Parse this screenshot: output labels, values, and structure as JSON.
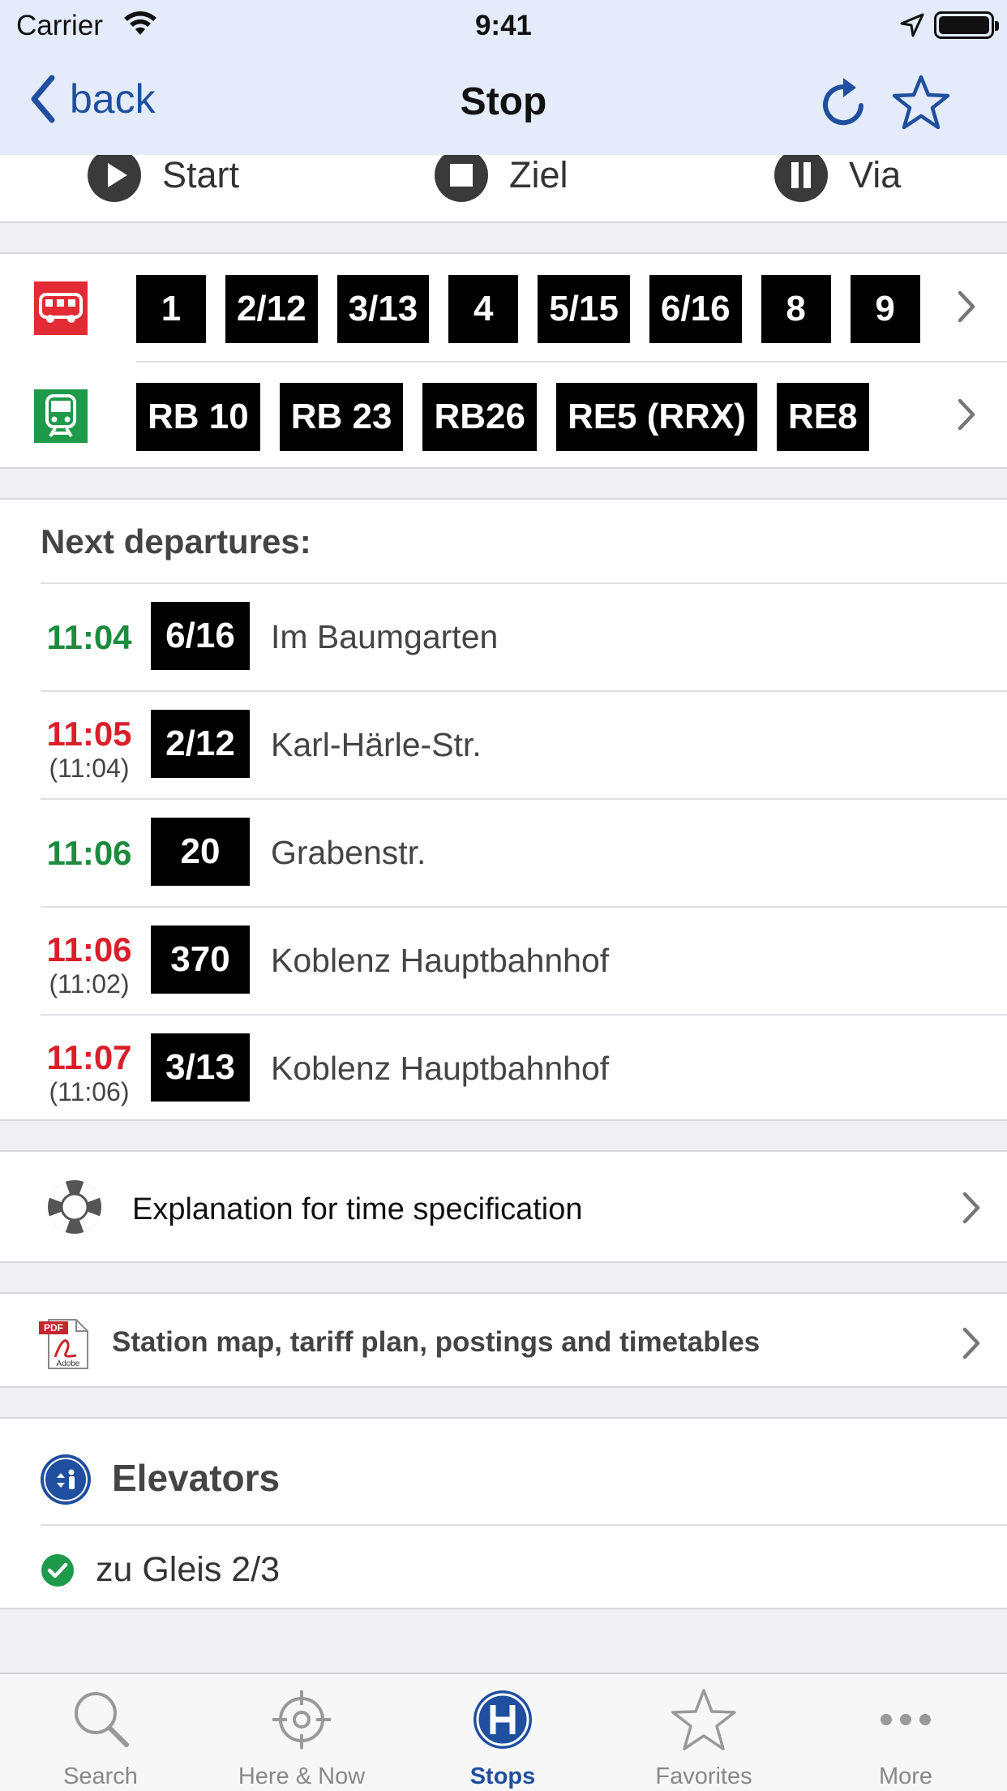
{
  "status_bar": {
    "carrier": "Carrier",
    "time": "9:41"
  },
  "nav": {
    "back_label": "back",
    "title": "Stop"
  },
  "actions": {
    "start": "Start",
    "ziel": "Ziel",
    "via": "Via"
  },
  "lines": {
    "bus": [
      "1",
      "2/12",
      "3/13",
      "4",
      "5/15",
      "6/16",
      "8",
      "9"
    ],
    "train": [
      "RB 10",
      "RB 23",
      "RB26",
      "RE5 (RRX)",
      "RE8"
    ]
  },
  "departures": {
    "heading": "Next departures:",
    "rows": [
      {
        "time": "11:04",
        "scheduled": "",
        "line": "6/16",
        "destination": "Im Baumgarten",
        "status": "ontime"
      },
      {
        "time": "11:05",
        "scheduled": "(11:04)",
        "line": "2/12",
        "destination": "Karl-Härle-Str.",
        "status": "late"
      },
      {
        "time": "11:06",
        "scheduled": "",
        "line": "20",
        "destination": "Grabenstr.",
        "status": "ontime"
      },
      {
        "time": "11:06",
        "scheduled": "(11:02)",
        "line": "370",
        "destination": "Koblenz Hauptbahnhof",
        "status": "late"
      },
      {
        "time": "11:07",
        "scheduled": "(11:06)",
        "line": "3/13",
        "destination": "Koblenz Hauptbahnhof",
        "status": "late"
      }
    ]
  },
  "explanation": {
    "label": "Explanation for time specification"
  },
  "pdf": {
    "label": "Station map, tariff plan, postings and timetables",
    "icon_text_top": "PDF",
    "icon_text_bottom": "Adobe"
  },
  "elevators": {
    "title": "Elevators",
    "items": [
      "zu Gleis 2/3"
    ]
  },
  "tabs": [
    {
      "label": "Search",
      "icon": "search-icon"
    },
    {
      "label": "Here & Now",
      "icon": "crosshair-icon"
    },
    {
      "label": "Stops",
      "icon": "stop-h-icon",
      "active": true
    },
    {
      "label": "Favorites",
      "icon": "star-icon"
    },
    {
      "label": "More",
      "icon": "more-icon"
    }
  ],
  "colors": {
    "accent": "#1f4f9e",
    "ontime": "#1e8a3e",
    "late": "#d81f2a",
    "header_bg": "#e4ecfb",
    "bus_red": "#e32b35",
    "train_green": "#1e9a4a"
  }
}
